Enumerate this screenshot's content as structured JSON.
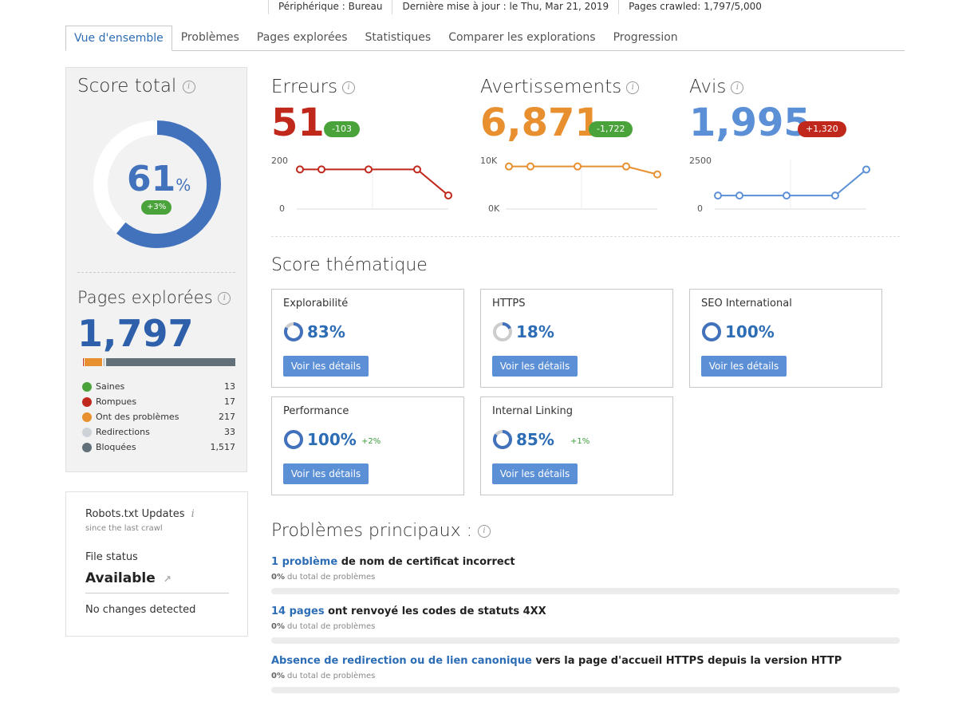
{
  "topbar": {
    "device": "Périphérique : Bureau",
    "updated": "Dernière mise à jour : le Thu, Mar 21, 2019",
    "crawled": "Pages crawled: 1,797/5,000"
  },
  "tabs": [
    "Vue d'ensemble",
    "Problèmes",
    "Pages explorées",
    "Statistiques",
    "Comparer les explorations",
    "Progression"
  ],
  "score": {
    "title": "Score total",
    "value": "61",
    "unit": "%",
    "delta": "+3%",
    "fraction": 0.61
  },
  "pages": {
    "title": "Pages explorées",
    "value": "1,797",
    "legend": [
      {
        "label": "Saines",
        "value": "13",
        "color": "#4aa23a"
      },
      {
        "label": "Rompues",
        "value": "17",
        "color": "#c0281c"
      },
      {
        "label": "Ont des problèmes",
        "value": "217",
        "color": "#e8902f"
      },
      {
        "label": "Redirections",
        "value": "33",
        "color": "#ccd3d8"
      },
      {
        "label": "Bloquées",
        "value": "1,517",
        "color": "#62707a"
      }
    ]
  },
  "robots": {
    "title": "Robots.txt Updates",
    "subtitle": "since the last crawl",
    "status_label": "File status",
    "status_value": "Available",
    "note": "No changes detected"
  },
  "metrics": [
    {
      "title": "Erreurs",
      "value": "51",
      "delta": "-103",
      "color": "#c0281c",
      "badge": "#4aa23a",
      "ymax": "200",
      "ymin": "0",
      "points": [
        160,
        160,
        160,
        160,
        55
      ],
      "scale": 200
    },
    {
      "title": "Avertissements",
      "value": "6,871",
      "delta": "-1,722",
      "color": "#e8902f",
      "badge": "#4aa23a",
      "ymax": "10K",
      "ymin": "0K",
      "points": [
        8600,
        8600,
        8600,
        8600,
        7000
      ],
      "scale": 10000
    },
    {
      "title": "Avis",
      "value": "1,995",
      "delta": "+1,320",
      "color": "#5b8fd6",
      "badge": "#c0281c",
      "ymax": "2500",
      "ymin": "0",
      "points": [
        680,
        680,
        680,
        680,
        1995
      ],
      "scale": 2500
    }
  ],
  "thematic": {
    "title": "Score thématique",
    "button": "Voir les détails",
    "cards": [
      {
        "title": "Explorabilité",
        "pct": "83%",
        "frac": 0.83,
        "delta": ""
      },
      {
        "title": "HTTPS",
        "pct": "18%",
        "frac": 0.18,
        "delta": ""
      },
      {
        "title": "SEO International",
        "pct": "100%",
        "frac": 1.0,
        "delta": ""
      },
      {
        "title": "Performance",
        "pct": "100%",
        "frac": 1.0,
        "delta": "+2%"
      },
      {
        "title": "Internal Linking",
        "pct": "85%",
        "frac": 0.85,
        "delta": "+1%"
      }
    ]
  },
  "issues": {
    "title": "Problèmes principaux :",
    "share_suffix": "du total de problèmes",
    "items": [
      {
        "link": "1 problème",
        "text": " de nom de certificat incorrect",
        "pct": "0%"
      },
      {
        "link": "14 pages",
        "text": " ont renvoyé les codes de statuts 4XX",
        "pct": "0%"
      },
      {
        "link": "Absence de redirection ou de lien canonique",
        "text": " vers la page d'accueil HTTPS depuis la version HTTP",
        "pct": "0%"
      }
    ]
  }
}
